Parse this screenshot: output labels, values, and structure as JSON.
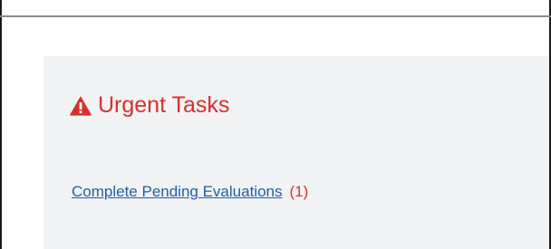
{
  "urgent": {
    "title": "Urgent Tasks",
    "icon": "warning-triangle-icon",
    "accent_color": "#d9302c",
    "tasks": [
      {
        "label": "Complete Pending Evaluations",
        "count": "(1)"
      }
    ]
  },
  "colors": {
    "link": "#1f5fa8",
    "panel_background": "#f2f3f5"
  }
}
